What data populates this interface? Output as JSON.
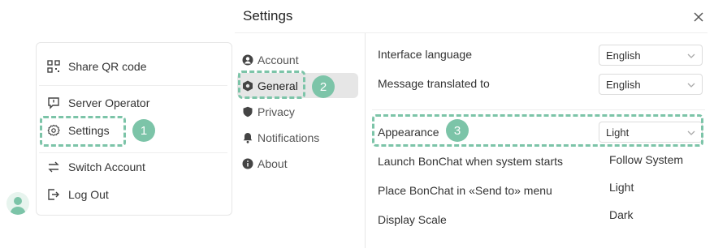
{
  "left_menu": {
    "items": [
      {
        "label": "Share QR code",
        "icon": "qr-code-icon"
      },
      {
        "label": "Server Operator",
        "icon": "chat-info-icon"
      },
      {
        "label": "Settings",
        "icon": "gear-icon"
      },
      {
        "label": "Switch Account",
        "icon": "swap-arrows-icon"
      },
      {
        "label": "Log Out",
        "icon": "logout-icon"
      }
    ]
  },
  "settings": {
    "title": "Settings",
    "nav": [
      {
        "label": "Account",
        "icon": "user-circle-icon"
      },
      {
        "label": "General",
        "icon": "hexagon-gear-icon"
      },
      {
        "label": "Privacy",
        "icon": "shield-icon"
      },
      {
        "label": "Notifications",
        "icon": "bell-icon"
      },
      {
        "label": "About",
        "icon": "info-icon"
      }
    ],
    "rows": {
      "interface_language": {
        "label": "Interface language",
        "value": "English"
      },
      "message_translated": {
        "label": "Message translated to",
        "value": "English"
      },
      "appearance": {
        "label": "Appearance",
        "value": "Light"
      },
      "launch": {
        "label": "Launch BonChat when system starts"
      },
      "send_to": {
        "label": "Place BonChat in «Send to» menu"
      },
      "display_scale": {
        "label": "Display Scale"
      }
    },
    "appearance_options": [
      "Follow System",
      "Light",
      "Dark"
    ]
  },
  "callouts": [
    "1",
    "2",
    "3"
  ],
  "colors": {
    "accent": "#7cc4a8",
    "selected_nav": "#e6e6e6"
  }
}
